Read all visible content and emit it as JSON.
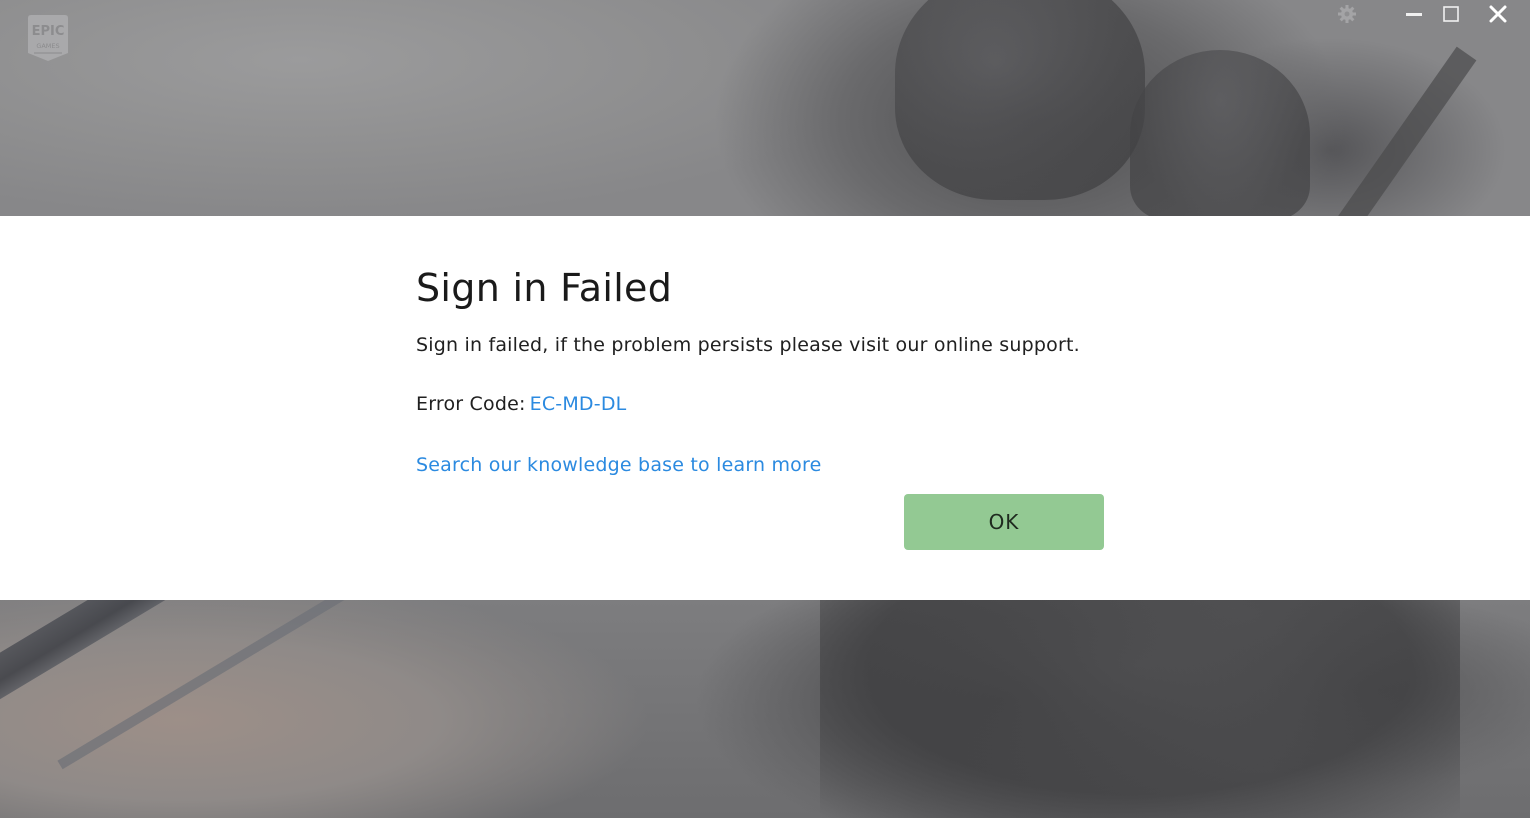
{
  "app": {
    "logo_text_top": "EPIC",
    "logo_text_bottom": "GAMES"
  },
  "window_controls": {
    "settings_icon": "gear-icon",
    "minimize_icon": "minimize-icon",
    "maximize_icon": "maximize-icon",
    "close_icon": "close-icon"
  },
  "dialog": {
    "title": "Sign in Failed",
    "message": "Sign in failed, if the problem persists please visit our online support.",
    "error_label": "Error Code:",
    "error_code": "EC-MD-DL",
    "kb_link": "Search our knowledge base to learn more",
    "ok_label": "OK"
  },
  "colors": {
    "link": "#2b8ae0",
    "ok_button": "#93c993",
    "dialog_bg": "#ffffff"
  }
}
